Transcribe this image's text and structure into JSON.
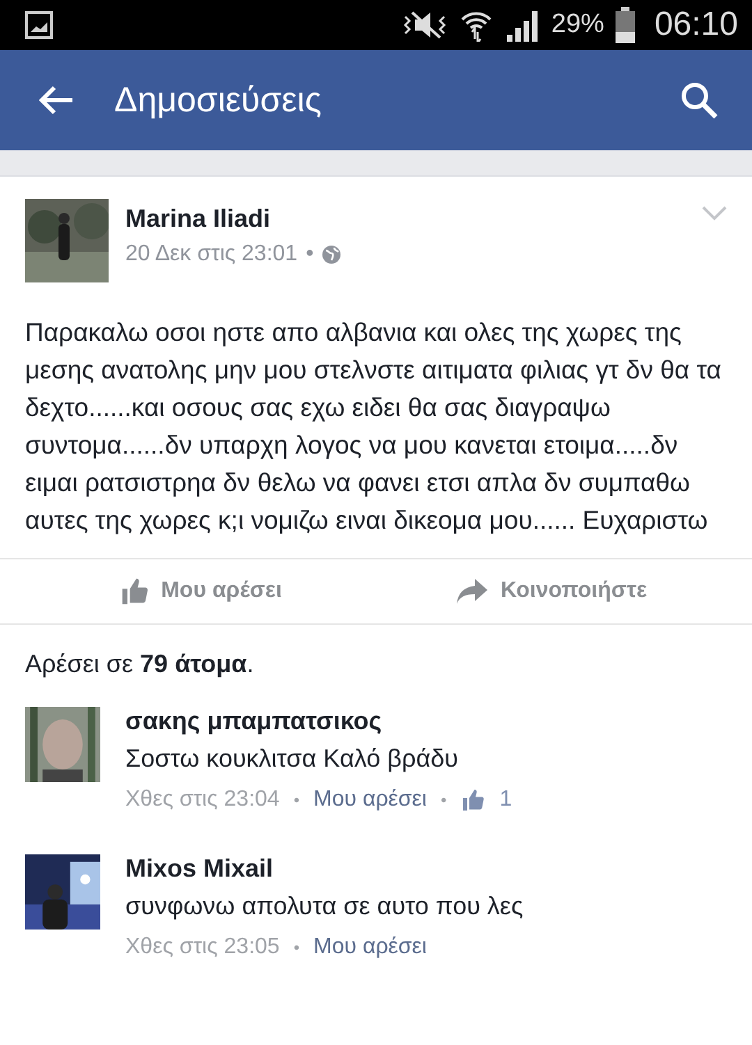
{
  "status_bar": {
    "battery_text": "29%",
    "time": "06:10"
  },
  "app_bar": {
    "title": "Δημοσιεύσεις"
  },
  "post": {
    "author": "Marina Iliadi",
    "meta": "20 Δεκ στις 23:01",
    "separator": "•",
    "text": "Παρακαλω οσοι ηστε απο αλβανια και ολες της χωρες της μεσης ανατολης μην μου στελνστε αιτιματα φιλιας γτ δν θα τα δεχτο......και οσους σας εχω ειδει θα σας διαγραψω συντομα......δν υπαρχη λογος να μου κανεται ετοιμα.....δν ειμαι ρατσιστρηα δν θελω να φανει ετσι απλα δν συμπαθω αυτες της χωρες κ;ι νομιζω ειναι δικεομα μου...... Ευχαριστω",
    "actions": [
      {
        "kind": "like",
        "label": "Μου αρέσει"
      },
      {
        "kind": "share",
        "label": "Κοινοποιήστε"
      }
    ]
  },
  "likes_summary": "Αρέσει σε **79 άτομα**.",
  "comments": [
    {
      "author": "σακης μπαμπατσικος",
      "text": "Σοστω κουκλιτσα Καλό βράδυ",
      "time": "Χθες στις 23:04",
      "like_link": "Μου αρέσει",
      "separator": "•",
      "like_count": "1"
    },
    {
      "author": "Mixos Mixail",
      "text": "συνφωνω απολυτα σε αυτο που λες",
      "time": "Χθες στις 23:05",
      "like_link": "Μου αρέσει",
      "separator": "•"
    }
  ]
}
